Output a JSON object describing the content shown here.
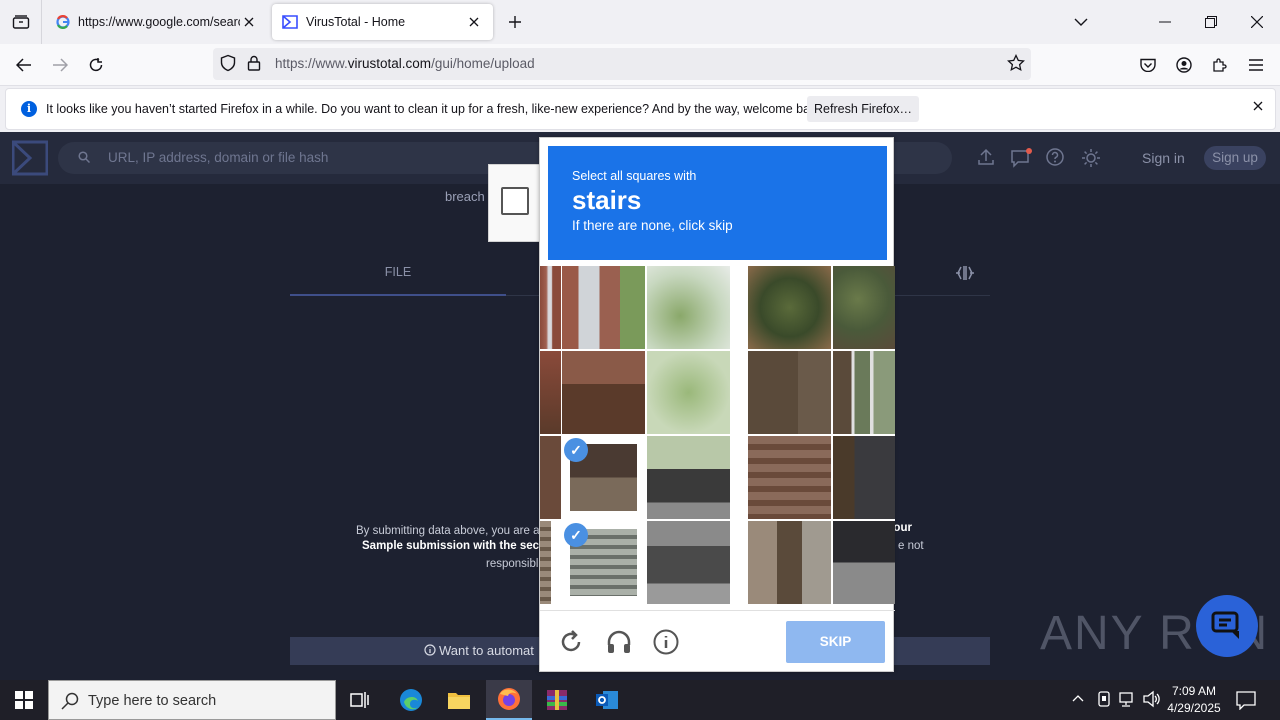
{
  "browser": {
    "tabs": [
      {
        "title": "https://www.google.com/searc",
        "favicon": "google-icon"
      },
      {
        "title": "VirusTotal - Home",
        "favicon": "virustotal-icon",
        "active": true
      }
    ],
    "url_prefix": "https://www.",
    "url_domain": "virustotal.com",
    "url_path": "/gui/home/upload"
  },
  "notification": {
    "message": "It looks like you haven’t started Firefox in a while. Do you want to clean it up for a fresh, like-new experience? And by the way, welcome back!",
    "button": "Refresh Firefox…"
  },
  "vt": {
    "search_placeholder": "URL, IP address, domain or file hash",
    "sign_in": "Sign in",
    "sign_up": "Sign up",
    "breach_fragment": "breach",
    "tab_file": "FILE",
    "terms_line1": "By submitting data above, you are ag",
    "terms_line2": "Sample submission with the secur",
    "terms_line3": "responsibl",
    "terms_right1": "f your",
    "terms_right2": "e not",
    "automate": "Want to automat",
    "watermark": "ANY RUN"
  },
  "captcha": {
    "prompt": "Select all squares with",
    "target": "stairs",
    "hint": "If there are none, click skip",
    "skip_label": "SKIP",
    "selected_tiles": [
      8,
      12
    ]
  },
  "taskbar": {
    "search_placeholder": "Type here to search",
    "time": "7:09 AM",
    "date": "4/29/2025"
  },
  "colors": {
    "captcha_blue": "#1a73e8",
    "vt_bg": "#1d2130"
  }
}
